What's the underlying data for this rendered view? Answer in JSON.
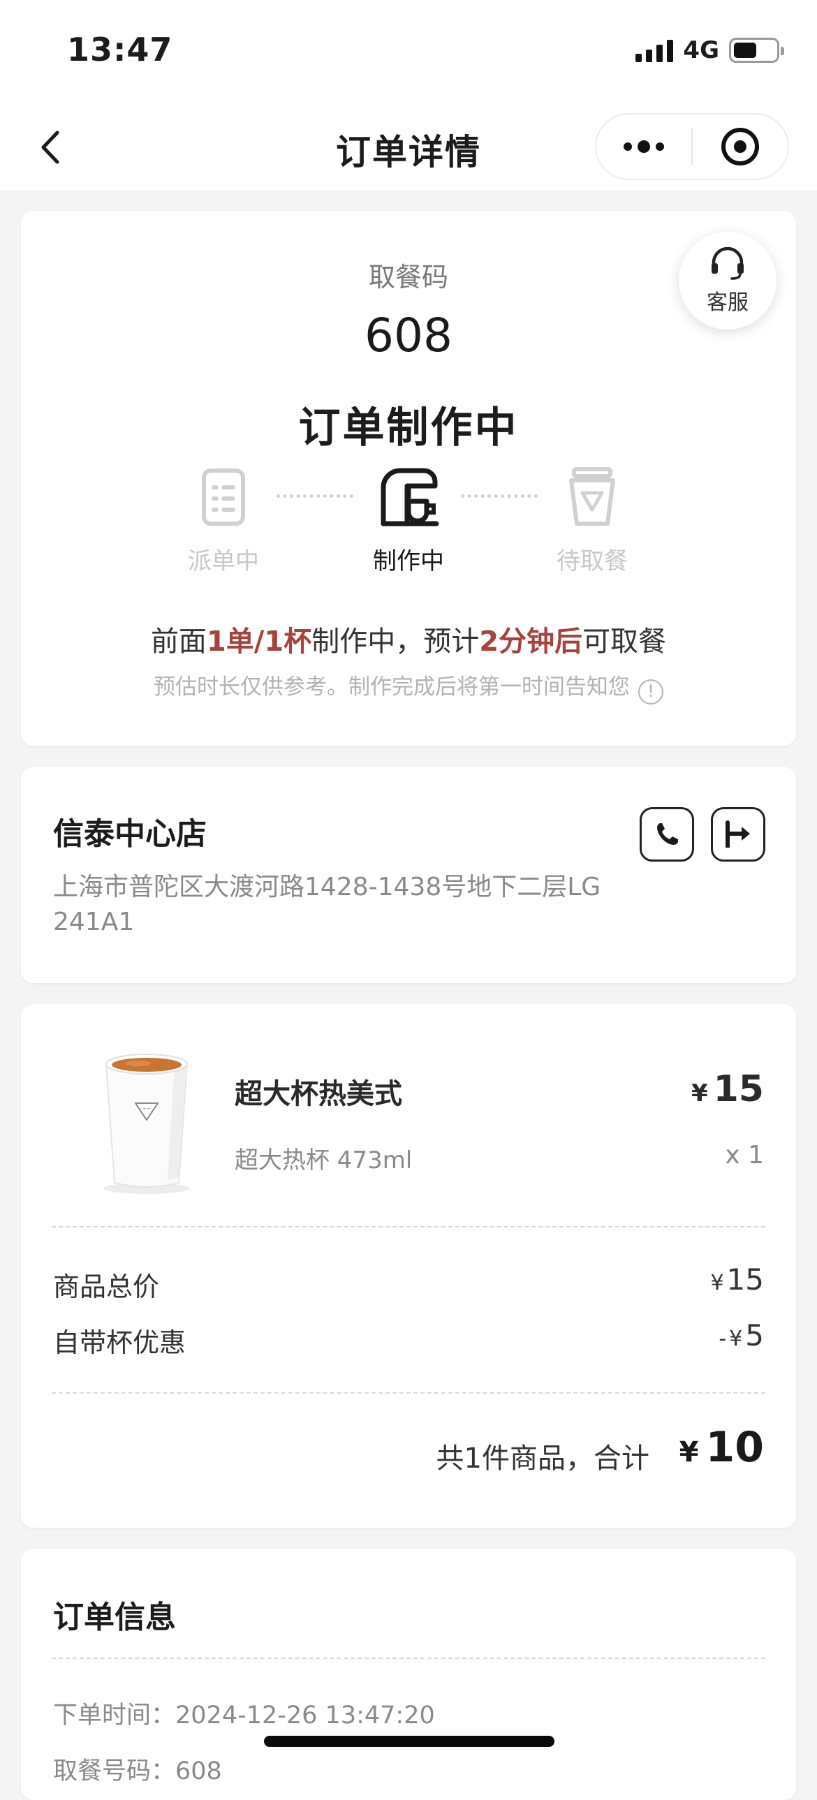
{
  "status_bar": {
    "time": "13:47",
    "network": "4G",
    "battery_level": 0.55
  },
  "nav": {
    "title": "订单详情",
    "back_icon": "chevron-left-icon",
    "more_icon": "more-dots-icon",
    "close_icon": "target-icon"
  },
  "status_card": {
    "pickup_label": "取餐码",
    "pickup_code": "608",
    "status_title": "订单制作中",
    "service_label": "客服",
    "steps": [
      {
        "label": "派单中",
        "icon": "order-list-icon",
        "state": "done"
      },
      {
        "label": "制作中",
        "icon": "coffee-machine-icon",
        "state": "active"
      },
      {
        "label": "待取餐",
        "icon": "cup-icon",
        "state": "pending"
      }
    ],
    "wait": {
      "prefix": "前面",
      "queue": "1单/1杯",
      "middle": "制作中，预计",
      "eta": "2分钟后",
      "suffix": "可取餐"
    },
    "note": "预估时长仅供参考。制作完成后将第一时间告知您",
    "accent_color": "#a6443b"
  },
  "store": {
    "name": "信泰中心店",
    "address": "上海市普陀区大渡河路1428-1438号地下二层LG 241A1",
    "call_icon": "phone-icon",
    "nav_icon": "navigate-arrow-icon"
  },
  "goods": {
    "items": [
      {
        "name": "超大杯热美式",
        "spec": "超大热杯 473ml",
        "currency": "¥",
        "price": "15",
        "qty": "x 1"
      }
    ],
    "subtotal_label": "商品总价",
    "subtotal_currency": "¥",
    "subtotal_value": "15",
    "discount_label": "自带杯优惠",
    "discount_prefix": "-",
    "discount_currency": "¥",
    "discount_value": "5",
    "total_text": "共1件商品，合计",
    "total_currency": "¥",
    "total_value": "10"
  },
  "order_info": {
    "title": "订单信息",
    "rows": [
      {
        "label": "下单时间：",
        "value": "2024-12-26 13:47:20"
      },
      {
        "label": "取餐号码：",
        "value": "608"
      }
    ]
  }
}
